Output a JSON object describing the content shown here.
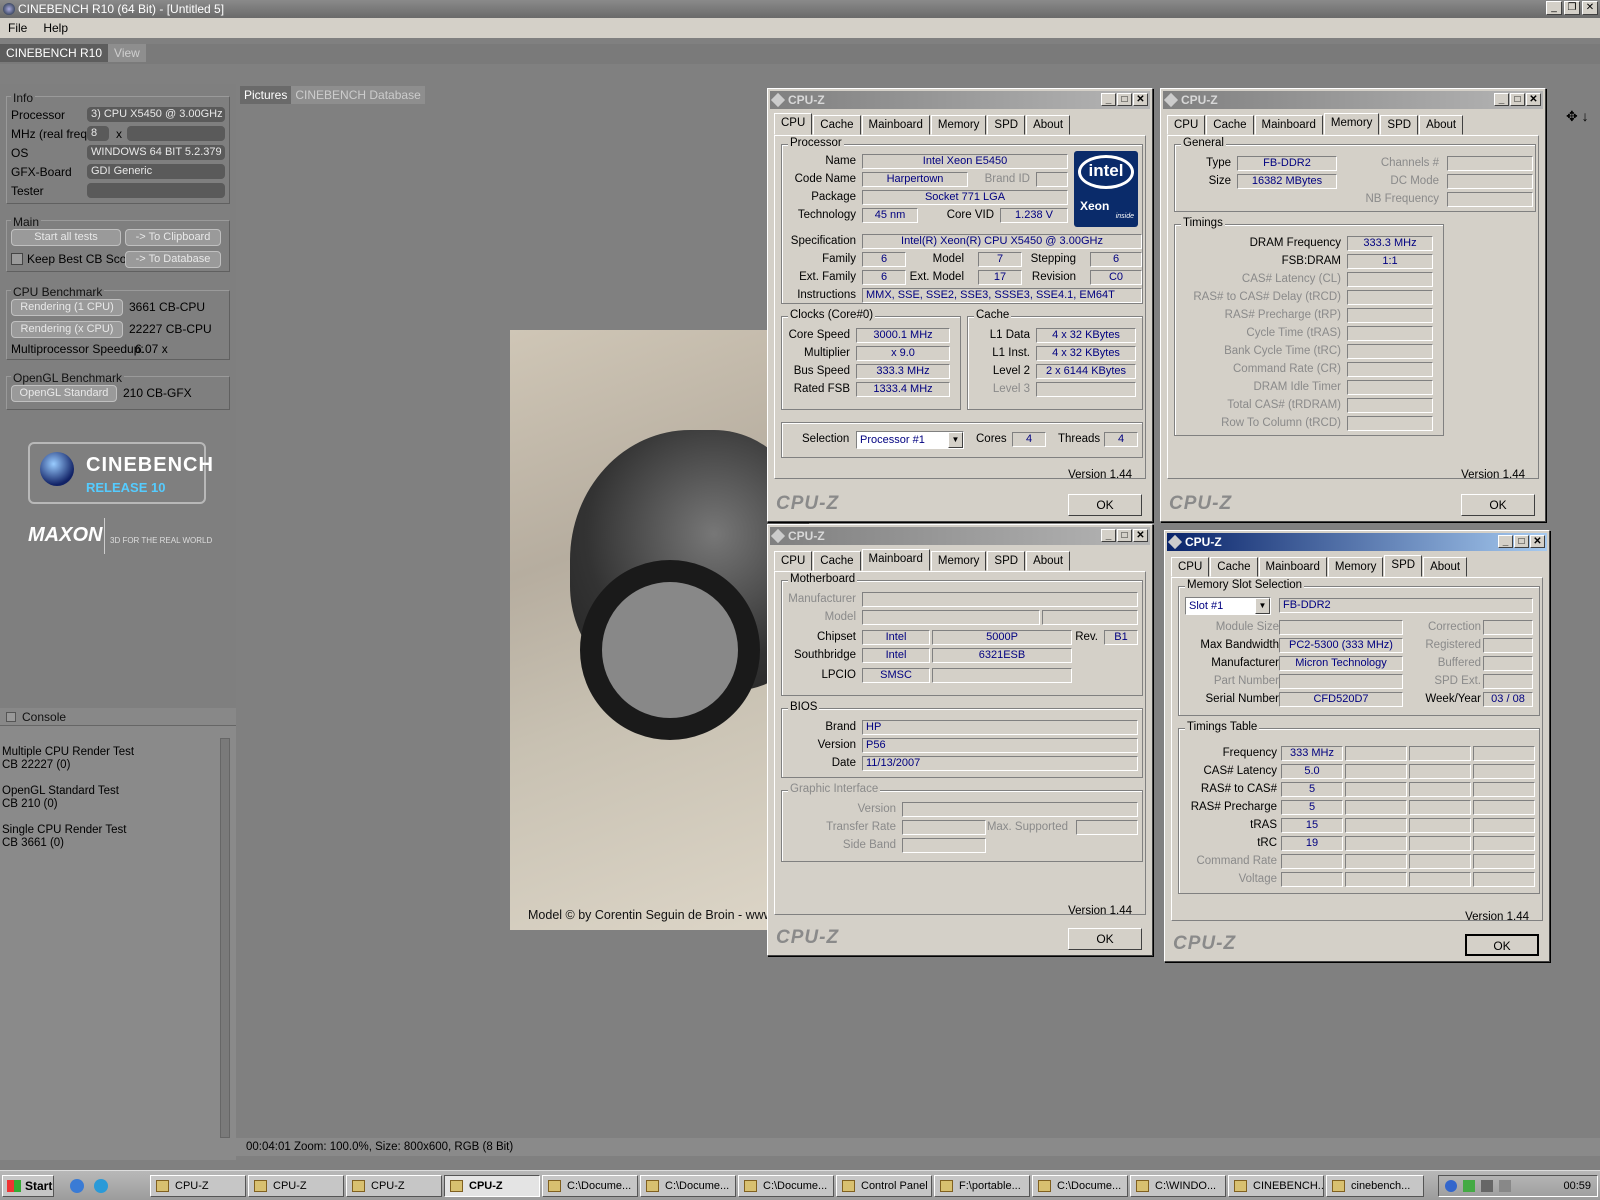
{
  "app": {
    "title": "CINEBENCH R10 (64 Bit) - [Untitled 5]",
    "menu": [
      "File",
      "Help"
    ],
    "tabs": [
      "CINEBENCH R10",
      "View"
    ]
  },
  "info": {
    "group": "Info",
    "processor_label": "Processor",
    "processor": "3) CPU X5450 @ 3.00GHz",
    "mhz_label": "MHz (real freq.)",
    "mhz": "8",
    "x": "x",
    "os_label": "OS",
    "os": "WINDOWS 64 BIT 5.2.379",
    "gfx_label": "GFX-Board",
    "gfx": "GDI Generic",
    "tester_label": "Tester"
  },
  "main": {
    "group": "Main",
    "start": "Start all tests",
    "clipboard": "-> To Clipboard",
    "keep": "Keep Best CB Score",
    "database": "-> To Database"
  },
  "cpu_bench": {
    "group": "CPU Benchmark",
    "r1": "Rendering (1 CPU)",
    "r1_val": "3661 CB-CPU",
    "rx": "Rendering (x CPU)",
    "rx_val": "22227 CB-CPU",
    "mp_label": "Multiprocessor Speedup:",
    "mp": "6.07 x"
  },
  "gl_bench": {
    "group": "OpenGL Benchmark",
    "btn": "OpenGL Standard",
    "val": "210 CB-GFX"
  },
  "logo": {
    "cinebench": "CINEBENCH",
    "release": "RELEASE 10",
    "maxon": "MAXON",
    "tagline": "3D FOR THE REAL WORLD"
  },
  "console": {
    "title": "Console",
    "lines": [
      "Multiple CPU Render Test",
      "CB 22227 (0)",
      "",
      "OpenGL Standard Test",
      "CB 210 (0)",
      "",
      "Single CPU Render Test",
      "CB 3661 (0)"
    ]
  },
  "render": {
    "tabs": [
      "Pictures",
      "CINEBENCH Database"
    ],
    "caption": "Model © by Corentin Seguin de Broin - www",
    "status": "00:04:01  Zoom: 100.0%, Size: 800x600, RGB (8 Bit)"
  },
  "cpuz_common": {
    "title": "CPU-Z",
    "tabs": [
      "CPU",
      "Cache",
      "Mainboard",
      "Memory",
      "SPD",
      "About"
    ],
    "version": "Version 1.44",
    "ok": "OK",
    "logo": "CPU-Z"
  },
  "cpuz_cpu": {
    "processor": "Processor",
    "name_l": "Name",
    "name": "Intel Xeon E5450",
    "code_l": "Code Name",
    "code": "Harpertown",
    "brand_l": "Brand ID",
    "pkg_l": "Package",
    "pkg": "Socket 771 LGA",
    "tech_l": "Technology",
    "tech": "45 nm",
    "vid_l": "Core VID",
    "vid": "1.238 V",
    "spec_l": "Specification",
    "spec": "Intel(R) Xeon(R) CPU          X5450  @ 3.00GHz",
    "fam_l": "Family",
    "fam": "6",
    "model_l": "Model",
    "model": "7",
    "step_l": "Stepping",
    "step": "6",
    "efam_l": "Ext. Family",
    "efam": "6",
    "emodel_l": "Ext. Model",
    "emodel": "17",
    "rev_l": "Revision",
    "rev": "C0",
    "instr_l": "Instructions",
    "instr": "MMX, SSE, SSE2, SSE3, SSSE3, SSE4.1, EM64T",
    "clocks": "Clocks (Core#0)",
    "cs_l": "Core Speed",
    "cs": "3000.1 MHz",
    "mul_l": "Multiplier",
    "mul": "x 9.0",
    "bus_l": "Bus Speed",
    "bus": "333.3 MHz",
    "fsb_l": "Rated FSB",
    "fsb": "1333.4 MHz",
    "cache": "Cache",
    "l1d_l": "L1 Data",
    "l1d": "4 x 32 KBytes",
    "l1i_l": "L1 Inst.",
    "l1i": "4 x 32 KBytes",
    "l2_l": "Level 2",
    "l2": "2 x 6144 KBytes",
    "l3_l": "Level 3",
    "sel_l": "Selection",
    "sel": "Processor #1",
    "cores_l": "Cores",
    "cores": "4",
    "threads_l": "Threads",
    "threads": "4",
    "intel": "intel",
    "xeon": "Xeon",
    "inside": "inside"
  },
  "cpuz_mem": {
    "general": "General",
    "type_l": "Type",
    "type": "FB-DDR2",
    "size_l": "Size",
    "size": "16382 MBytes",
    "ch_l": "Channels #",
    "dc_l": "DC Mode",
    "nb_l": "NB Frequency",
    "timings": "Timings",
    "dram_l": "DRAM Frequency",
    "dram": "333.3 MHz",
    "fsbd_l": "FSB:DRAM",
    "fsbd": "1:1",
    "cl_l": "CAS# Latency (CL)",
    "trcd_l": "RAS# to CAS# Delay (tRCD)",
    "trp_l": "RAS# Precharge (tRP)",
    "tras_l": "Cycle Time (tRAS)",
    "trc_l": "Bank Cycle Time (tRC)",
    "cr_l": "Command Rate (CR)",
    "idle_l": "DRAM Idle Timer",
    "trdram_l": "Total CAS# (tRDRAM)",
    "rtc_l": "Row To Column (tRCD)"
  },
  "cpuz_mb": {
    "mb": "Motherboard",
    "manu_l": "Manufacturer",
    "model_l": "Model",
    "chip_l": "Chipset",
    "chip_v": "Intel",
    "chip": "5000P",
    "rev_l": "Rev.",
    "rev": "B1",
    "sb_l": "Southbridge",
    "sb_v": "Intel",
    "sb": "6321ESB",
    "lpc_l": "LPCIO",
    "lpc": "SMSC",
    "bios": "BIOS",
    "brand_l": "Brand",
    "brand": "HP",
    "ver_l": "Version",
    "ver": "P56",
    "date_l": "Date",
    "date": "11/13/2007",
    "gi": "Graphic Interface",
    "gver_l": "Version",
    "tr_l": "Transfer Rate",
    "max_l": "Max. Supported",
    "sbnd_l": "Side Band"
  },
  "cpuz_spd": {
    "mss": "Memory Slot Selection",
    "slot": "Slot #1",
    "type": "FB-DDR2",
    "ms_l": "Module Size",
    "corr_l": "Correction",
    "mb_l": "Max Bandwidth",
    "mb": "PC2-5300 (333 MHz)",
    "reg_l": "Registered",
    "man_l": "Manufacturer",
    "man": "Micron Technology",
    "buf_l": "Buffered",
    "pn_l": "Part Number",
    "spdext_l": "SPD Ext.",
    "sn_l": "Serial Number",
    "sn": "CFD520D7",
    "wy_l": "Week/Year",
    "wy": "03 / 08",
    "tt": "Timings Table",
    "freq_l": "Frequency",
    "freq": "333 MHz",
    "cas_l": "CAS# Latency",
    "cas": "5.0",
    "rc_l": "RAS# to CAS#",
    "rc": "5",
    "rp_l": "RAS# Precharge",
    "rp": "5",
    "tras_l": "tRAS",
    "tras": "15",
    "trc_l": "tRC",
    "trc": "19",
    "cr_l": "Command Rate",
    "volt_l": "Voltage"
  },
  "taskbar": {
    "start": "Start",
    "items": [
      "CPU-Z",
      "CPU-Z",
      "CPU-Z",
      "CPU-Z",
      "C:\\Docume...",
      "C:\\Docume...",
      "C:\\Docume...",
      "Control Panel",
      "F:\\portable...",
      "C:\\Docume...",
      "C:\\WINDO...",
      "CINEBENCH...",
      "cinebench..."
    ],
    "clock": "00:59"
  }
}
